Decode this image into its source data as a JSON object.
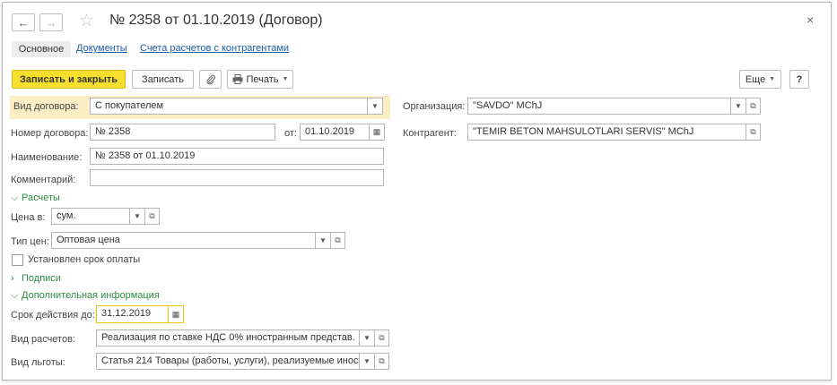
{
  "window": {
    "title": "№ 2358 от 01.10.2019 (Договор)",
    "back_icon": "←",
    "forward_icon": "→",
    "star_icon": "☆",
    "close_icon": "×"
  },
  "tabs": [
    {
      "label": "Основное"
    },
    {
      "label": "Документы"
    },
    {
      "label": "Счета расчетов с контрагентами"
    }
  ],
  "toolbar": {
    "save_close_label": "Записать и закрыть",
    "save_label": "Записать",
    "attach_icon": "paperclip-icon",
    "print_label": "Печать",
    "more_label": "Еще",
    "help_label": "?"
  },
  "form": {
    "contract_type": {
      "label": "Вид договора:",
      "value": "С покупателем"
    },
    "contract_number": {
      "label": "Номер договора:",
      "value": "№ 2358"
    },
    "date": {
      "label": "от:",
      "value": "01.10.2019"
    },
    "name": {
      "label": "Наименование:",
      "value": "№ 2358 от 01.10.2019"
    },
    "comment": {
      "label": "Комментарий:",
      "value": ""
    },
    "organization": {
      "label": "Организация:",
      "value": "\"SAVDO\" MChJ"
    },
    "counterparty": {
      "label": "Контрагент:",
      "value": "\"TEMIR BETON MAHSULOTLARI SERVIS\" MChJ"
    }
  },
  "settlements": {
    "group_label": "Расчеты",
    "price_in": {
      "label": "Цена в:",
      "value": "сум."
    },
    "price_type": {
      "label": "Тип цен:",
      "value": "Оптовая цена"
    },
    "payment_term": {
      "label": "Установлен срок оплаты",
      "checked": false
    }
  },
  "signatures": {
    "group_label": "Подписи"
  },
  "additional": {
    "group_label": "Дополнительная информация",
    "valid_until": {
      "label": "Срок действия до:",
      "value": "31.12.2019"
    },
    "settlement_kind": {
      "label": "Вид расчетов:",
      "value": "Реализация по ставке НДС 0% иностранным представ."
    },
    "benefit_kind": {
      "label": "Вид льготы:",
      "value": "Статья 214 Товары (работы, услуги), реализуемые  иност"
    }
  },
  "colors": {
    "primary_button": "#f7e02b",
    "group_header": "#2c8a45",
    "link": "#1a5caa",
    "highlight": "#fbeec4",
    "focus_border": "#f1c40f"
  }
}
